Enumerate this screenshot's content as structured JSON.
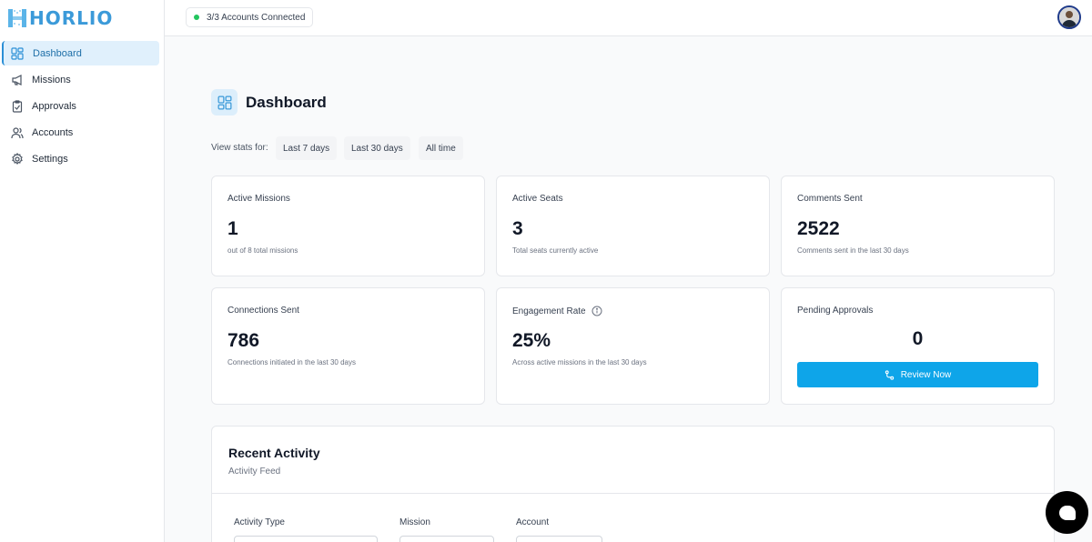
{
  "brand": {
    "logo_text": "HORLIO"
  },
  "sidebar": {
    "items": [
      {
        "label": "Dashboard",
        "icon": "dashboard-grid-icon",
        "active": true
      },
      {
        "label": "Missions",
        "icon": "megaphone-icon"
      },
      {
        "label": "Approvals",
        "icon": "clipboard-check-icon"
      },
      {
        "label": "Accounts",
        "icon": "users-icon"
      },
      {
        "label": "Settings",
        "icon": "gear-icon"
      }
    ]
  },
  "topbar": {
    "connection_status": "3/3 Accounts Connected",
    "status_color": "#22c55e"
  },
  "page": {
    "title": "Dashboard",
    "stats_label": "View stats for:",
    "ranges": [
      "Last 7 days",
      "Last 30 days",
      "All time"
    ]
  },
  "cards": {
    "active_missions": {
      "title": "Active Missions",
      "value": "1",
      "sub": "out of 8 total missions"
    },
    "active_seats": {
      "title": "Active Seats",
      "value": "3",
      "sub": "Total seats currently active"
    },
    "comments_sent": {
      "title": "Comments Sent",
      "value": "2522",
      "sub": "Comments sent in the last 30 days"
    },
    "connections_sent": {
      "title": "Connections Sent",
      "value": "786",
      "sub": "Connections initiated in the last 30 days"
    },
    "engagement_rate": {
      "title": "Engagement Rate",
      "value": "25%",
      "sub": "Across active missions in the last 30 days"
    },
    "pending_approvals": {
      "title": "Pending Approvals",
      "value": "0",
      "button": "Review Now"
    }
  },
  "activity": {
    "title": "Recent Activity",
    "subtitle": "Activity Feed",
    "filters": [
      "Activity Type",
      "Mission",
      "Account"
    ]
  },
  "colors": {
    "accent": "#0ea5e9",
    "active_nav_bg": "#e0f0fc"
  }
}
